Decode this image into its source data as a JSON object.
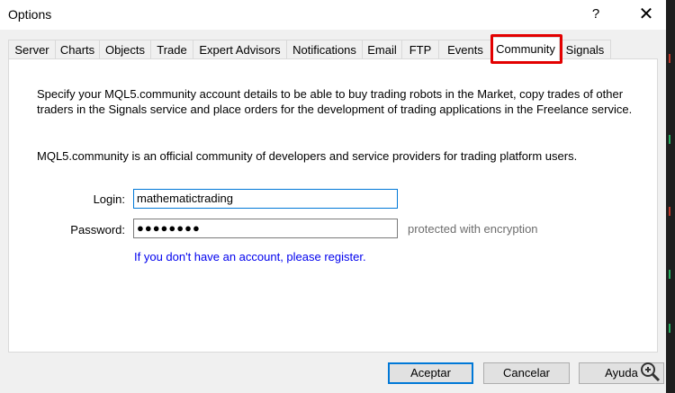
{
  "window": {
    "title": "Options",
    "help_glyph": "?",
    "close_glyph": "✕"
  },
  "tabs": [
    {
      "label": "Server"
    },
    {
      "label": "Charts"
    },
    {
      "label": "Objects"
    },
    {
      "label": "Trade"
    },
    {
      "label": "Expert Advisors"
    },
    {
      "label": "Notifications"
    },
    {
      "label": "Email"
    },
    {
      "label": "FTP"
    },
    {
      "label": "Events"
    },
    {
      "label": "Community",
      "active": true
    },
    {
      "label": "Signals"
    }
  ],
  "community": {
    "intro_line1": "Specify your MQL5.community account details to be able to buy trading robots in the Market, copy trades of other",
    "intro_line2": "traders in the Signals service and place orders for the development of trading applications in the Freelance service.",
    "about": "MQL5.community is an official community of developers and service providers for trading platform users.",
    "login_label": "Login:",
    "login_value": "mathematictrading",
    "password_label": "Password:",
    "password_value": "●●●●●●●●",
    "password_hint": "protected with encryption",
    "register_link": "If you don't have an account, please register."
  },
  "buttons": {
    "accept": "Aceptar",
    "cancel": "Cancelar",
    "help": "Ayuda"
  },
  "colors": {
    "highlight": "#e30000",
    "link": "#0000ee",
    "focus": "#0078d7"
  }
}
